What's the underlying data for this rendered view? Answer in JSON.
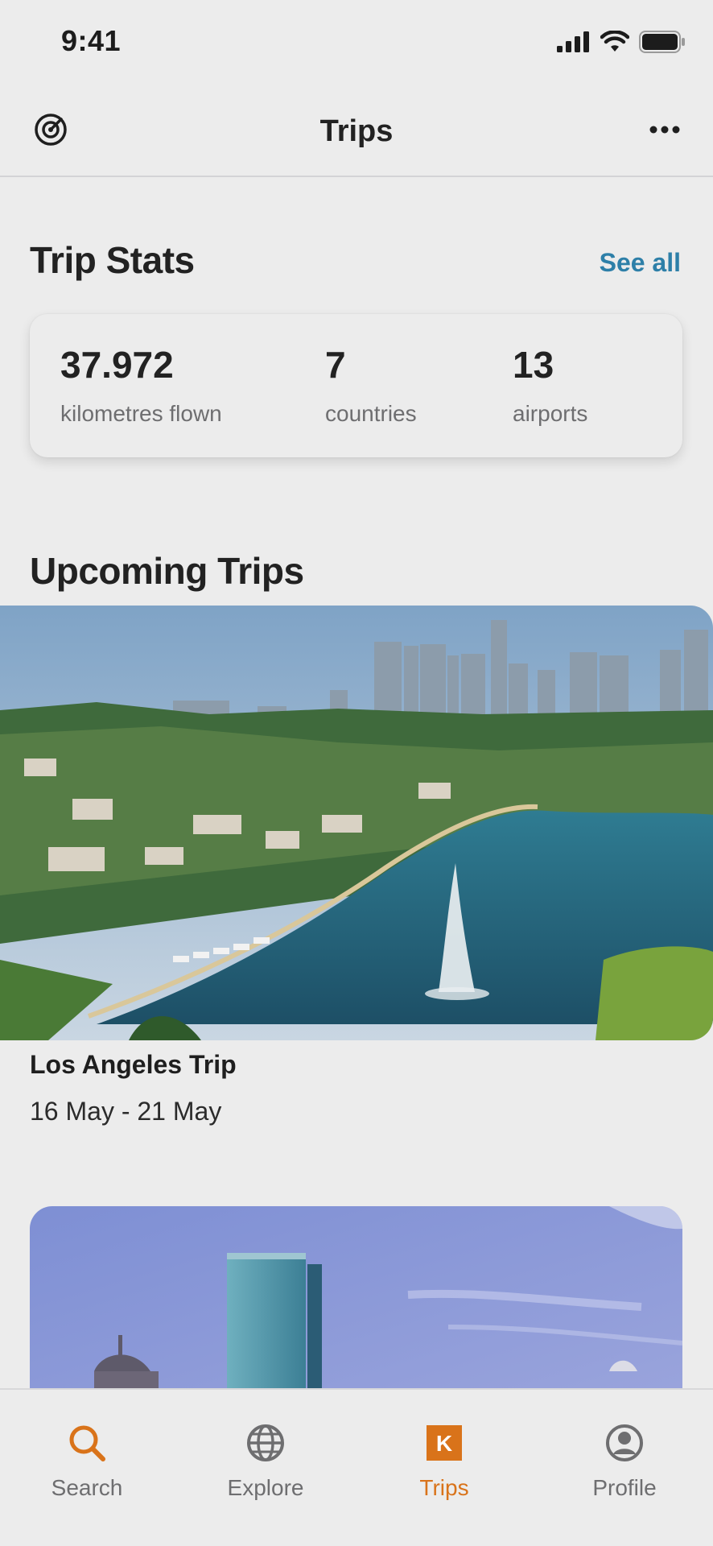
{
  "status_bar": {
    "time": "9:41"
  },
  "header": {
    "title": "Trips"
  },
  "trip_stats": {
    "title": "Trip Stats",
    "see_all": "See all",
    "stats": [
      {
        "value": "37.972",
        "label": "kilometres flown"
      },
      {
        "value": "7",
        "label": "countries"
      },
      {
        "value": "13",
        "label": "airports"
      }
    ]
  },
  "upcoming": {
    "title": "Upcoming Trips",
    "trips": [
      {
        "name": "Los Angeles Trip",
        "dates": "16 May - 21 May"
      }
    ]
  },
  "tab_bar": {
    "tabs": [
      {
        "label": "Search",
        "icon": "search-icon"
      },
      {
        "label": "Explore",
        "icon": "globe-icon"
      },
      {
        "label": "Trips",
        "icon": "trips-k-icon",
        "active": true
      },
      {
        "label": "Profile",
        "icon": "profile-icon"
      }
    ]
  },
  "colors": {
    "accent": "#d9731a",
    "link": "#2d7fa8",
    "background": "#ececec"
  }
}
